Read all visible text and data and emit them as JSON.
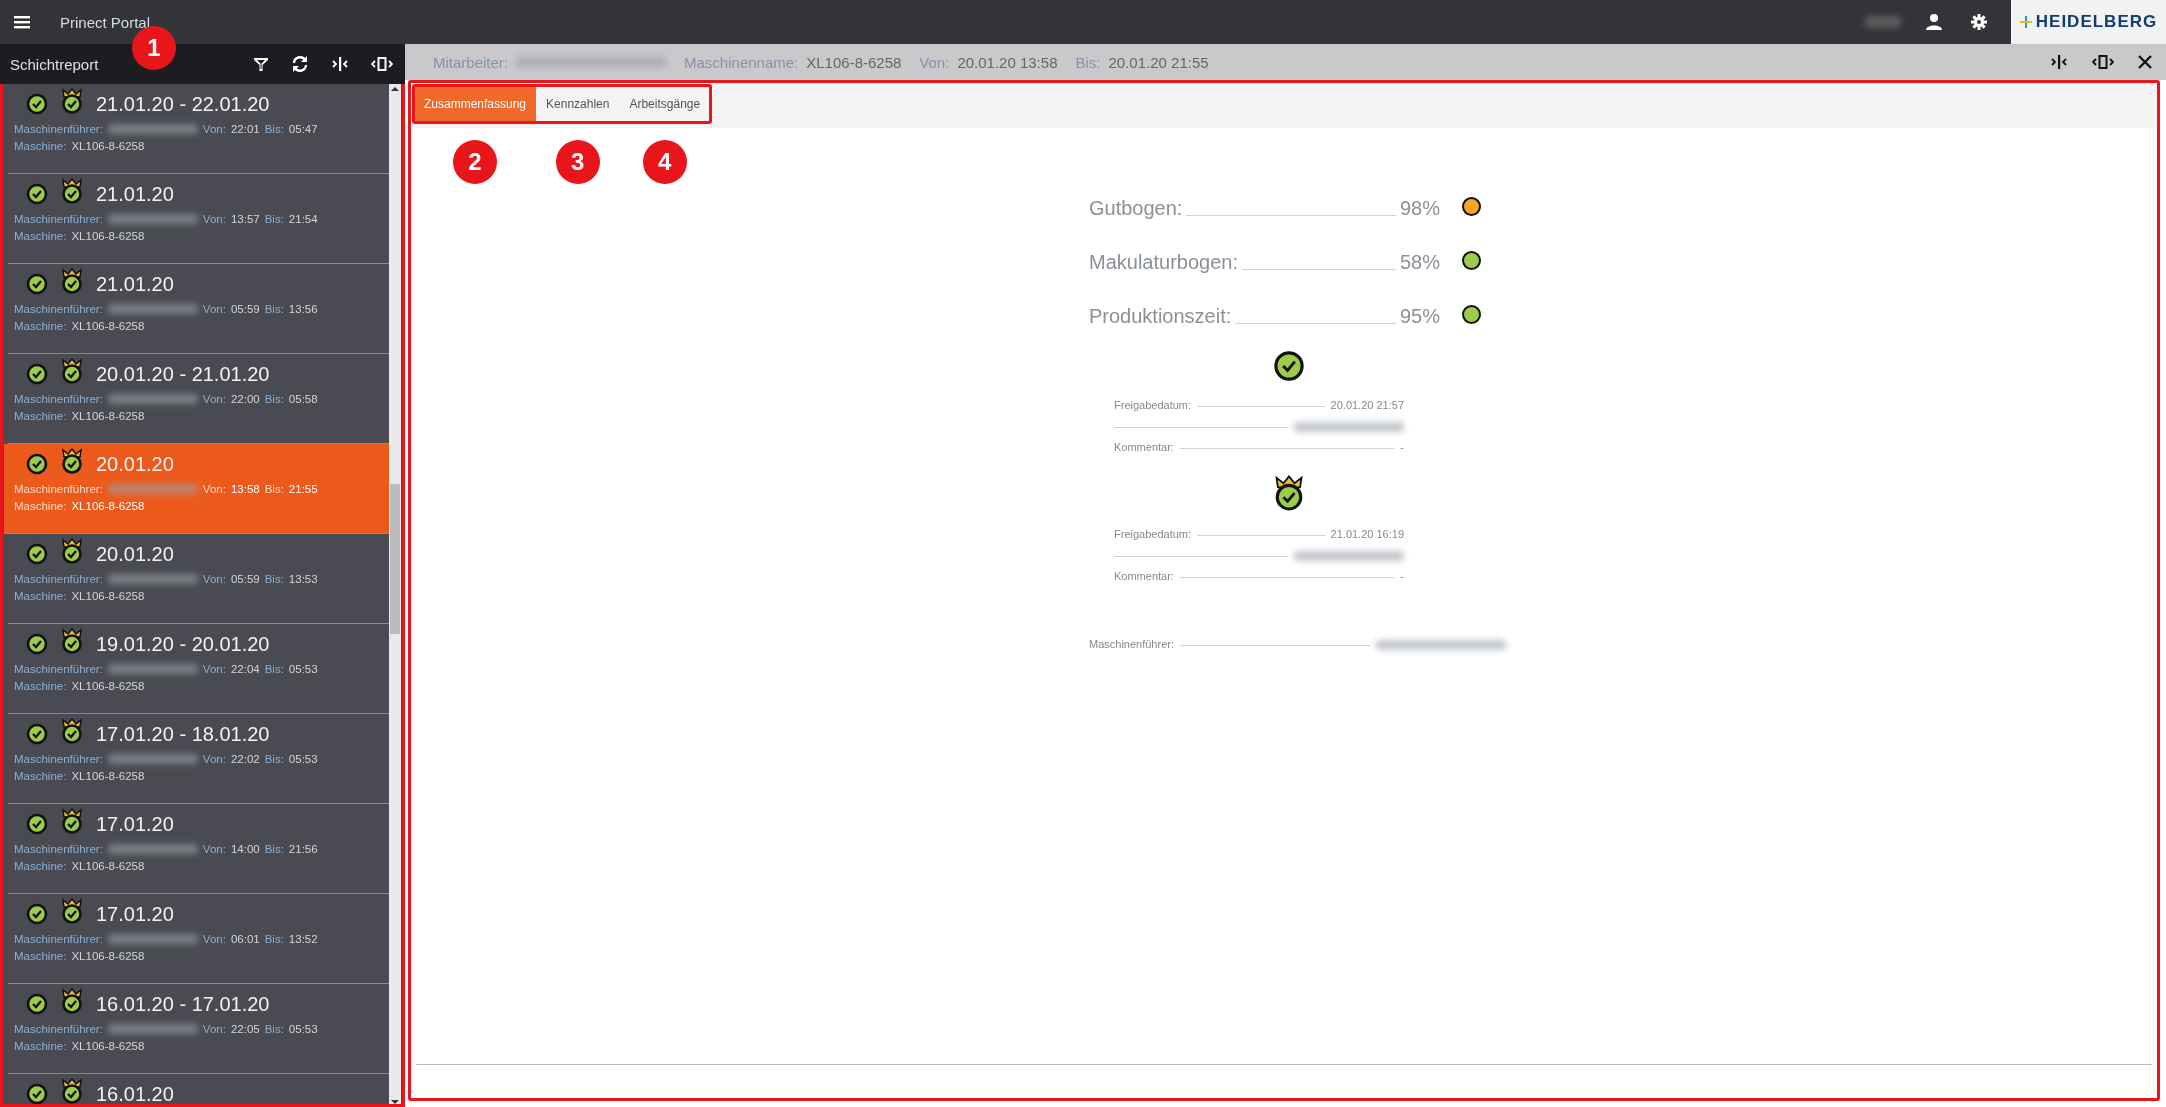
{
  "app_bar": {
    "title": "Prinect Portal",
    "brand": "HEIDELBERG"
  },
  "sidebar": {
    "title": "Schichtreport",
    "callout": "1",
    "items": [
      {
        "date": "21.01.20 - 22.01.20",
        "operator_label": "Maschinenführer:",
        "von_label": "Von:",
        "von": "22:01",
        "bis_label": "Bis:",
        "bis": "05:47",
        "machine_label": "Maschine:",
        "machine": "XL106-8-6258",
        "selected": false
      },
      {
        "date": "21.01.20",
        "operator_label": "Maschinenführer:",
        "von_label": "Von:",
        "von": "13:57",
        "bis_label": "Bis:",
        "bis": "21:54",
        "machine_label": "Maschine:",
        "machine": "XL106-8-6258",
        "selected": false
      },
      {
        "date": "21.01.20",
        "operator_label": "Maschinenführer:",
        "von_label": "Von:",
        "von": "05:59",
        "bis_label": "Bis:",
        "bis": "13:56",
        "machine_label": "Maschine:",
        "machine": "XL106-8-6258",
        "selected": false
      },
      {
        "date": "20.01.20 - 21.01.20",
        "operator_label": "Maschinenführer:",
        "von_label": "Von:",
        "von": "22:00",
        "bis_label": "Bis:",
        "bis": "05:58",
        "machine_label": "Maschine:",
        "machine": "XL106-8-6258",
        "selected": false
      },
      {
        "date": "20.01.20",
        "operator_label": "Maschinenführer:",
        "von_label": "Von:",
        "von": "13:58",
        "bis_label": "Bis:",
        "bis": "21:55",
        "machine_label": "Maschine:",
        "machine": "XL106-8-6258",
        "selected": true
      },
      {
        "date": "20.01.20",
        "operator_label": "Maschinenführer:",
        "von_label": "Von:",
        "von": "05:59",
        "bis_label": "Bis:",
        "bis": "13:53",
        "machine_label": "Maschine:",
        "machine": "XL106-8-6258",
        "selected": false
      },
      {
        "date": "19.01.20 - 20.01.20",
        "operator_label": "Maschinenführer:",
        "von_label": "Von:",
        "von": "22:04",
        "bis_label": "Bis:",
        "bis": "05:53",
        "machine_label": "Maschine:",
        "machine": "XL106-8-6258",
        "selected": false
      },
      {
        "date": "17.01.20 - 18.01.20",
        "operator_label": "Maschinenführer:",
        "von_label": "Von:",
        "von": "22:02",
        "bis_label": "Bis:",
        "bis": "05:53",
        "machine_label": "Maschine:",
        "machine": "XL106-8-6258",
        "selected": false
      },
      {
        "date": "17.01.20",
        "operator_label": "Maschinenführer:",
        "von_label": "Von:",
        "von": "14:00",
        "bis_label": "Bis:",
        "bis": "21:56",
        "machine_label": "Maschine:",
        "machine": "XL106-8-6258",
        "selected": false
      },
      {
        "date": "17.01.20",
        "operator_label": "Maschinenführer:",
        "von_label": "Von:",
        "von": "06:01",
        "bis_label": "Bis:",
        "bis": "13:52",
        "machine_label": "Maschine:",
        "machine": "XL106-8-6258",
        "selected": false
      },
      {
        "date": "16.01.20 - 17.01.20",
        "operator_label": "Maschinenführer:",
        "von_label": "Von:",
        "von": "22:05",
        "bis_label": "Bis:",
        "bis": "05:53",
        "machine_label": "Maschine:",
        "machine": "XL106-8-6258",
        "selected": false
      },
      {
        "date": "16.01.20",
        "selected": false
      }
    ]
  },
  "detail_header": {
    "fields": [
      {
        "label": "Mitarbeiter:",
        "kind": "redacted"
      },
      {
        "label": "Maschinenname:",
        "kind": "text",
        "value": "XL106-8-6258"
      },
      {
        "label": "Von:",
        "kind": "text",
        "value": "20.01.20 13:58"
      },
      {
        "label": "Bis:",
        "kind": "text",
        "value": "20.01.20 21:55"
      }
    ]
  },
  "main": {
    "outlined": true
  },
  "tab_strip": {
    "outlined": true,
    "tabs": [
      {
        "label": "Zusammenfassung",
        "selected": true,
        "callout": "2"
      },
      {
        "label": "Kennzahlen",
        "selected": false,
        "callout": "3"
      },
      {
        "label": "Arbeitsgänge",
        "selected": false,
        "callout": "4"
      }
    ]
  },
  "metrics": [
    {
      "label": "Gutbogen:",
      "value": "98%",
      "color": "#f5a623"
    },
    {
      "label": "Makulaturbogen:",
      "value": "58%",
      "color": "#9ccc4a"
    },
    {
      "label": "Produktionszeit:",
      "value": "95%",
      "color": "#9ccc4a"
    }
  ],
  "approvals": [
    {
      "kind": "check",
      "date_label": "Freigabedatum:",
      "date": "20.01.20 21:57",
      "comment_label": "Kommentar:",
      "comment": "-"
    },
    {
      "kind": "crown",
      "date_label": "Freigabedatum:",
      "date": "21.01.20 16:19",
      "comment_label": "Kommentar:",
      "comment": "-"
    }
  ],
  "footer": {
    "operator_label": "Maschinenführer:"
  }
}
